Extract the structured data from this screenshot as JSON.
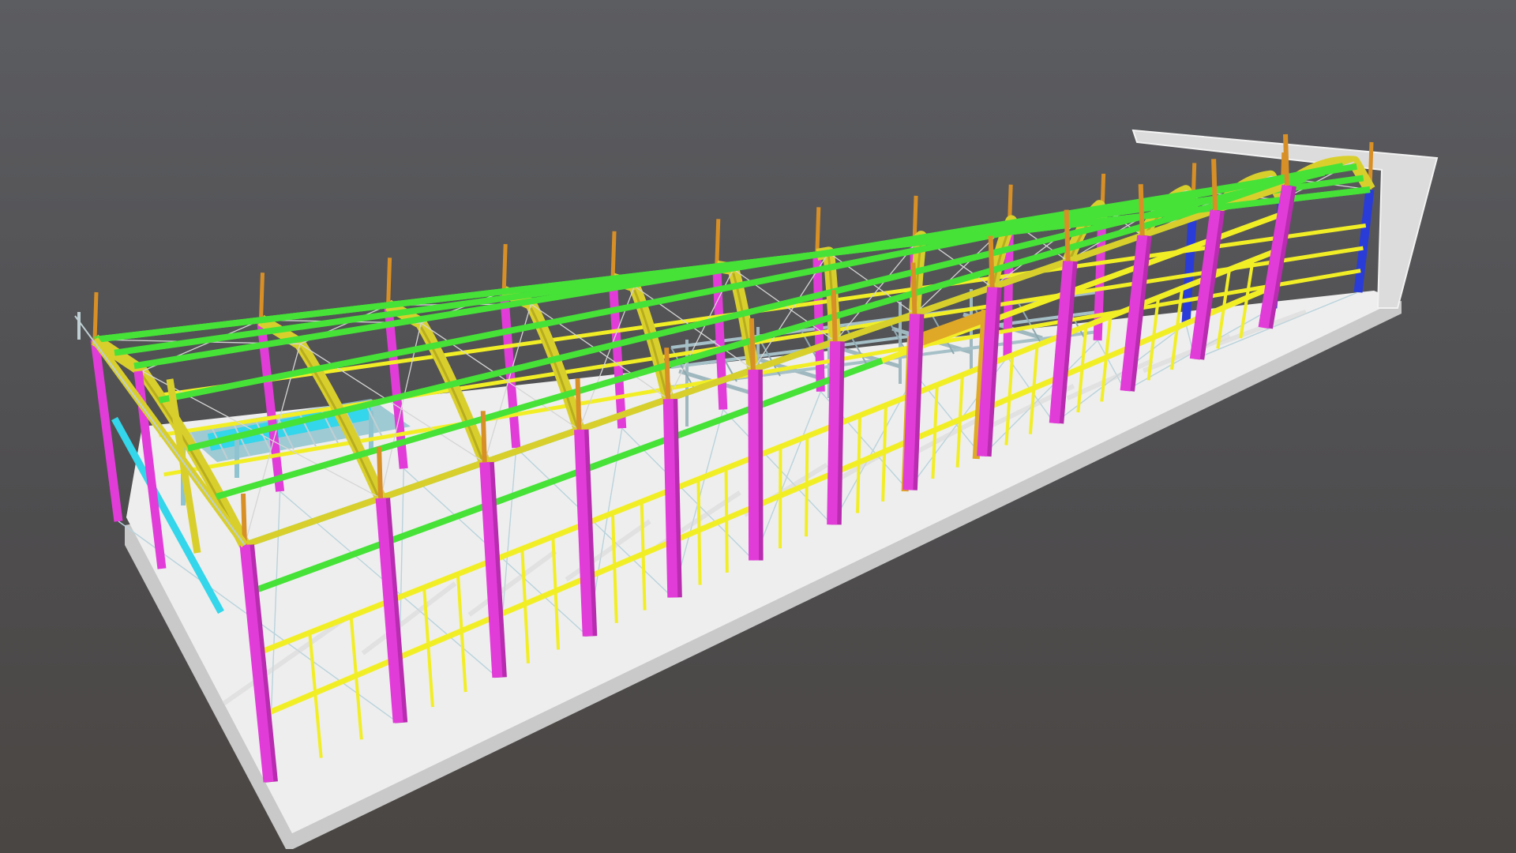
{
  "viewer": {
    "model": "steel-frame-building",
    "background": {
      "top": "#5c5d61",
      "bottom": "#4a4643"
    }
  },
  "palette": {
    "slab_top": "#eeeeee",
    "slab_side": "#c9c9c9",
    "column": "#e23cd8",
    "column_shade": "#b82cb0",
    "rafter": "#d9cf2c",
    "purlin": "#46e238",
    "rail": "#f2ee26",
    "brace": "#bfcfd3",
    "stub": "#d89026",
    "gable_column": "#2a3cd8",
    "mezzanine": "#8fc3cf",
    "mezzanine_accent": "#33d6ea",
    "end_wall": "#dcdcdc"
  },
  "structure": {
    "frames": 13,
    "roof_purlin_lines": 7,
    "wall_rail_lines": 3
  }
}
